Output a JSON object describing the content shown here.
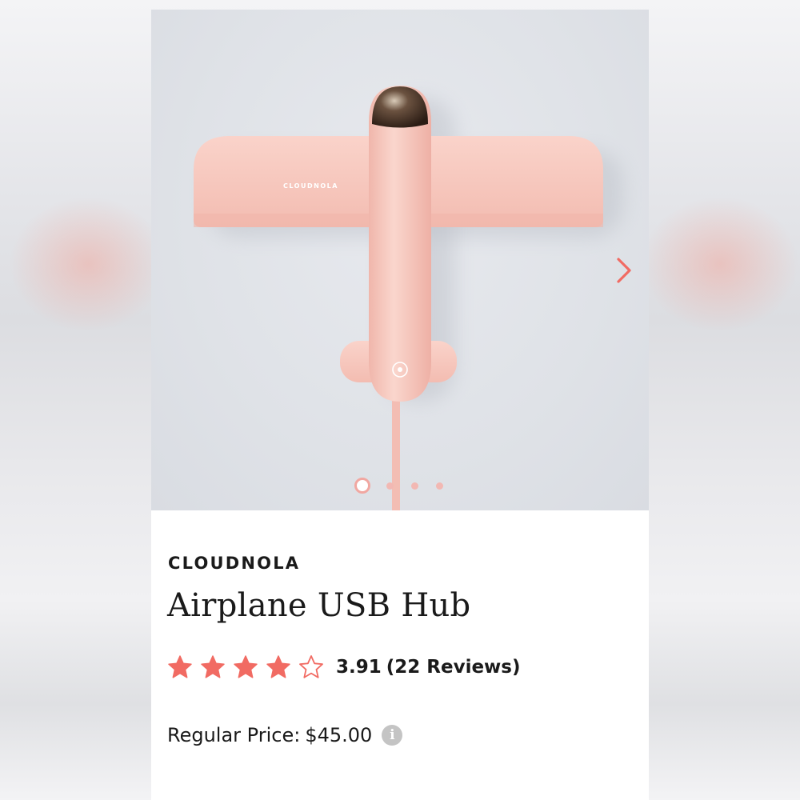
{
  "product": {
    "brand": "CLOUDNOLA",
    "title": "Airplane USB Hub",
    "image_alt_brand": "CLOUDNOLA",
    "rating": {
      "value": 3.91,
      "value_label": "3.91",
      "reviews_label": "(22 Reviews)",
      "stars_filled": 4,
      "stars_total": 5
    },
    "price": {
      "label": "Regular Price:",
      "amount": "$45.00"
    }
  },
  "carousel": {
    "slide_count": 4,
    "active_index": 0,
    "next_icon": "chevron-right-icon"
  },
  "icons": {
    "star": "star-icon",
    "star_empty": "star-outline-icon",
    "info": "info-icon",
    "info_glyph": "i"
  },
  "colors": {
    "accent": "#f16b63",
    "product_pink": "#f6c6bd",
    "dot_inactive": "#f2b8b3",
    "text": "#1a1a1a",
    "info_gray": "#c4c4c4"
  }
}
